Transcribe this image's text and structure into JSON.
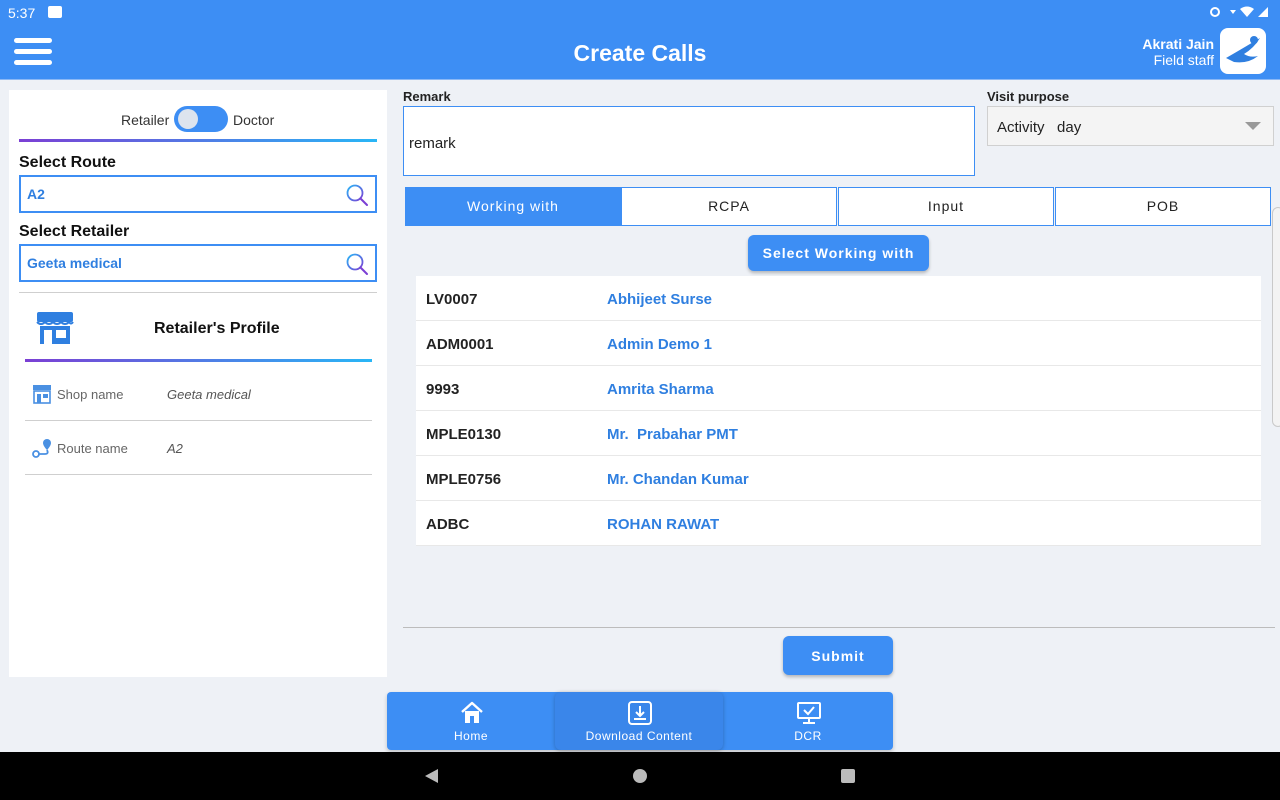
{
  "status_bar": {
    "time": "5:37"
  },
  "header": {
    "title": "Create Calls",
    "user_name": "Akrati Jain",
    "user_role": "Field staff"
  },
  "left_panel": {
    "toggle": {
      "left_label": "Retailer",
      "right_label": "Doctor"
    },
    "route_label": "Select Route",
    "route_value": "A2",
    "retailer_label": "Select Retailer",
    "retailer_value": "Geeta medical",
    "profile_title": "Retailer's Profile",
    "profile_rows": [
      {
        "key": "Shop name",
        "value": "Geeta medical"
      },
      {
        "key": "Route name",
        "value": "A2"
      }
    ]
  },
  "remark": {
    "label": "Remark",
    "value": "remark"
  },
  "visit_purpose": {
    "label": "Visit purpose",
    "value": "Activity   day"
  },
  "tabs": [
    {
      "label": "Working with"
    },
    {
      "label": "RCPA"
    },
    {
      "label": "Input"
    },
    {
      "label": "POB"
    }
  ],
  "select_working_with_label": "Select Working with",
  "working_with": [
    {
      "code": "LV0007",
      "name": "Abhijeet Surse"
    },
    {
      "code": "ADM0001",
      "name": "Admin Demo 1"
    },
    {
      "code": "9993",
      "name": "Amrita Sharma"
    },
    {
      "code": "MPLE0130",
      "name": "Mr.  Prabahar PMT"
    },
    {
      "code": "MPLE0756",
      "name": "Mr. Chandan Kumar"
    },
    {
      "code": "ADBC",
      "name": "ROHAN RAWAT"
    }
  ],
  "submit_label": "Submit",
  "bottom_nav": [
    {
      "label": "Home",
      "icon": "home-icon"
    },
    {
      "label": "Download Content",
      "icon": "download-icon"
    },
    {
      "label": "DCR",
      "icon": "monitor-check-icon"
    }
  ],
  "colors": {
    "primary": "#3d8ef4",
    "link": "#2f7fe0",
    "gradient_start": "#7b3fd4",
    "gradient_end": "#29b6f6"
  }
}
